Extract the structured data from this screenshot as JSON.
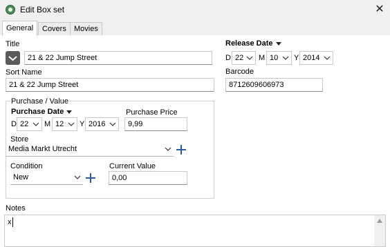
{
  "window": {
    "title": "Edit Box set"
  },
  "tabs": [
    {
      "label": "General"
    },
    {
      "label": "Covers"
    },
    {
      "label": "Movies"
    }
  ],
  "title_field": {
    "label": "Title",
    "value": "21 & 22 Jump Street"
  },
  "sort_name": {
    "label": "Sort Name",
    "value": "21 & 22 Jump Street"
  },
  "release_date": {
    "label": "Release Date",
    "d_label": "D",
    "d_value": "22",
    "m_label": "M",
    "m_value": "10",
    "y_label": "Y",
    "y_value": "2014"
  },
  "barcode": {
    "label": "Barcode",
    "value": "8712609606973"
  },
  "purchase": {
    "group_label": "Purchase / Value",
    "date": {
      "label": "Purchase Date",
      "d_label": "D",
      "d_value": "22",
      "m_label": "M",
      "m_value": "12",
      "y_label": "Y",
      "y_value": "2016"
    },
    "price": {
      "label": "Purchase Price",
      "value": "9,99"
    },
    "store": {
      "label": "Store",
      "value": "Media Markt Utrecht"
    },
    "condition": {
      "label": "Condition",
      "value": "New"
    },
    "current_value": {
      "label": "Current Value",
      "value": "0,00"
    }
  },
  "notes": {
    "label": "Notes",
    "value": "x"
  },
  "icons": {
    "app": "app-icon",
    "close": "close-icon",
    "collapse": "chevron-down-icon",
    "add": "plus-icon"
  },
  "colors": {
    "accent": "#2e5c9e",
    "window_bg": "#f0f0f0",
    "panel_bg": "#ffffff"
  }
}
